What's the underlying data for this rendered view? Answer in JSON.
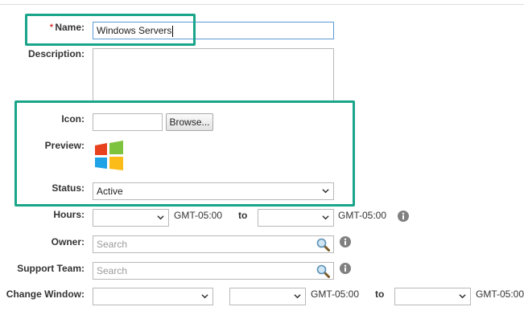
{
  "form": {
    "name": {
      "label": "Name:",
      "required_mark": "*",
      "value": "Windows Servers"
    },
    "description": {
      "label": "Description:"
    },
    "icon": {
      "label": "Icon:",
      "browse_label": "Browse..."
    },
    "preview": {
      "label": "Preview:",
      "icon": "windows-logo-icon"
    },
    "status": {
      "label": "Status:",
      "selected": "Active"
    },
    "hours": {
      "label": "Hours:",
      "from_tz": "GMT-05:00",
      "to_label": "to",
      "to_tz": "GMT-05:00",
      "info_icon": "info-icon"
    },
    "owner": {
      "label": "Owner:",
      "placeholder": "Search",
      "search_icon": "magnifier-icon",
      "info_icon": "info-icon"
    },
    "support_team": {
      "label": "Support Team:",
      "placeholder": "Search",
      "search_icon": "magnifier-icon",
      "info_icon": "info-icon"
    },
    "change_window": {
      "label": "Change Window:",
      "from_tz": "GMT-05:00",
      "to_label": "to",
      "to_tz": "GMT-05:00"
    }
  },
  "colors": {
    "highlight": "#1aa58a",
    "required": "#cc0000",
    "focus_border": "#5b9bd5",
    "info_icon": "#808080"
  }
}
